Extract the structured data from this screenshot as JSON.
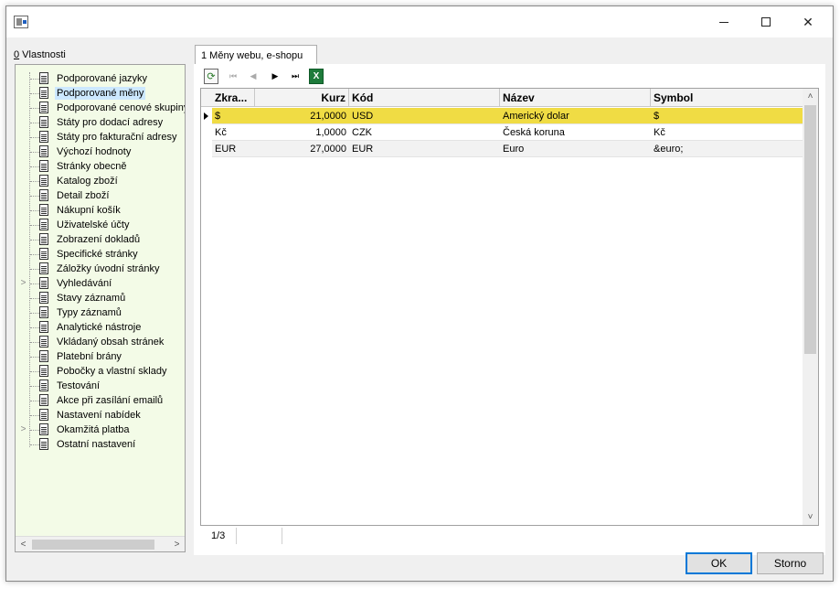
{
  "window": {
    "minimize_glyph": "—",
    "maximize_glyph": "☐",
    "close_glyph": "✕"
  },
  "properties": {
    "hotkey": "0",
    "label": " Vlastnosti"
  },
  "tree": {
    "selected_index": 1,
    "items": [
      {
        "label": "Podporované jazyky",
        "expandable": false
      },
      {
        "label": "Podporované měny",
        "expandable": false
      },
      {
        "label": "Podporované cenové skupiny",
        "expandable": false
      },
      {
        "label": "Státy pro dodací adresy",
        "expandable": false
      },
      {
        "label": "Státy pro fakturační adresy",
        "expandable": false
      },
      {
        "label": "Výchozí hodnoty",
        "expandable": false
      },
      {
        "label": "Stránky obecně",
        "expandable": false
      },
      {
        "label": "Katalog zboží",
        "expandable": false
      },
      {
        "label": "Detail zboží",
        "expandable": false
      },
      {
        "label": "Nákupní košík",
        "expandable": false
      },
      {
        "label": "Uživatelské účty",
        "expandable": false
      },
      {
        "label": "Zobrazení dokladů",
        "expandable": false
      },
      {
        "label": "Specifické stránky",
        "expandable": false
      },
      {
        "label": "Záložky úvodní stránky",
        "expandable": false
      },
      {
        "label": "Vyhledávání",
        "expandable": true
      },
      {
        "label": "Stavy záznamů",
        "expandable": false
      },
      {
        "label": "Typy záznamů",
        "expandable": false
      },
      {
        "label": "Analytické nástroje",
        "expandable": false
      },
      {
        "label": "Vkládaný obsah stránek",
        "expandable": false
      },
      {
        "label": "Platební brány",
        "expandable": false
      },
      {
        "label": "Pobočky a vlastní sklady",
        "expandable": false
      },
      {
        "label": "Testování",
        "expandable": false
      },
      {
        "label": "Akce při zasílání emailů",
        "expandable": false
      },
      {
        "label": "Nastavení nabídek",
        "expandable": false
      },
      {
        "label": "Okamžitá platba",
        "expandable": true
      },
      {
        "label": "Ostatní nastavení",
        "expandable": false
      }
    ]
  },
  "tab": {
    "label": "1 Měny webu, e-shopu"
  },
  "toolbar": {
    "refresh_glyph": "⟳",
    "first_glyph": "⏮",
    "prev_glyph": "◀",
    "next_glyph": "▶",
    "last_glyph": "⏭",
    "excel_glyph": "X"
  },
  "grid": {
    "columns": [
      "Zkra...",
      "Kurz",
      "Kód",
      "Název",
      "Symbol"
    ],
    "selected_row": 0,
    "rows": [
      [
        "$",
        "21,0000",
        "USD",
        "Americký dolar",
        "$"
      ],
      [
        "Kč",
        "1,0000",
        "CZK",
        "Česká koruna",
        "Kč"
      ],
      [
        "EUR",
        "27,0000",
        "EUR",
        "Euro",
        "&euro;"
      ]
    ]
  },
  "status": {
    "record_count": "1/3"
  },
  "buttons": {
    "ok": "OK",
    "cancel": "Storno"
  },
  "colors": {
    "tree_background": "#f3fbe7",
    "selected_row": "#f0dc44",
    "selected_tree_item": "#cce8ff",
    "ok_border": "#0078d7"
  }
}
